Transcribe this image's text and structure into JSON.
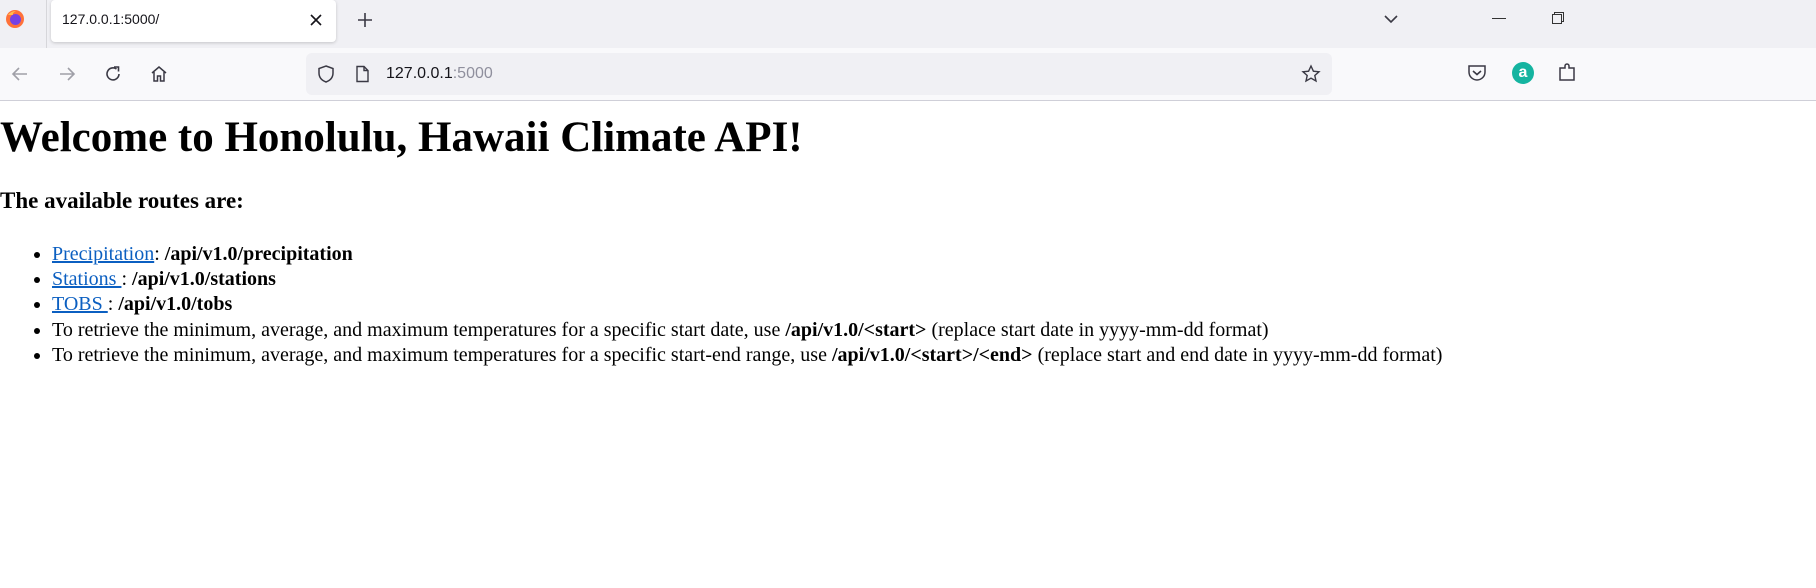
{
  "browser": {
    "tab_title": "127.0.0.1:5000/",
    "url_host": "127.0.0.1",
    "url_port": ":5000"
  },
  "page": {
    "heading": "Welcome to Honolulu, Hawaii Climate API!",
    "subheading": "The available routes are:",
    "routes": [
      {
        "link": "Precipitation",
        "sep": ": ",
        "path": "/api/v1.0/precipitation"
      },
      {
        "link": "Stations ",
        "sep": ": ",
        "path": "/api/v1.0/stations"
      },
      {
        "link": "TOBS ",
        "sep": ": ",
        "path": "/api/v1.0/tobs"
      }
    ],
    "start_item": {
      "pre": "To retrieve the minimum, average, and maximum temperatures for a specific start date, use ",
      "path": "/api/v1.0/<start>",
      "post": " (replace start date in yyyy-mm-dd format)"
    },
    "range_item": {
      "pre": "To retrieve the minimum, average, and maximum temperatures for a specific start-end range, use ",
      "path": "/api/v1.0/<start>/<end>",
      "post": " (replace start and end date in yyyy-mm-dd format)"
    }
  },
  "icons": {
    "firefox": "firefox-logo-icon",
    "close": "close-icon",
    "new_tab": "plus-icon",
    "tab_list": "chevron-down-icon",
    "back": "back-arrow-icon",
    "forward": "forward-arrow-icon",
    "reload": "reload-icon",
    "home": "home-icon",
    "shield": "shield-icon",
    "page": "page-icon",
    "bookmark": "star-icon",
    "pocket": "pocket-icon",
    "account": "account-icon"
  },
  "colors": {
    "link": "#0b5fc1",
    "account": "#15b4a0",
    "tabstrip_bg": "#f0f0f4"
  }
}
